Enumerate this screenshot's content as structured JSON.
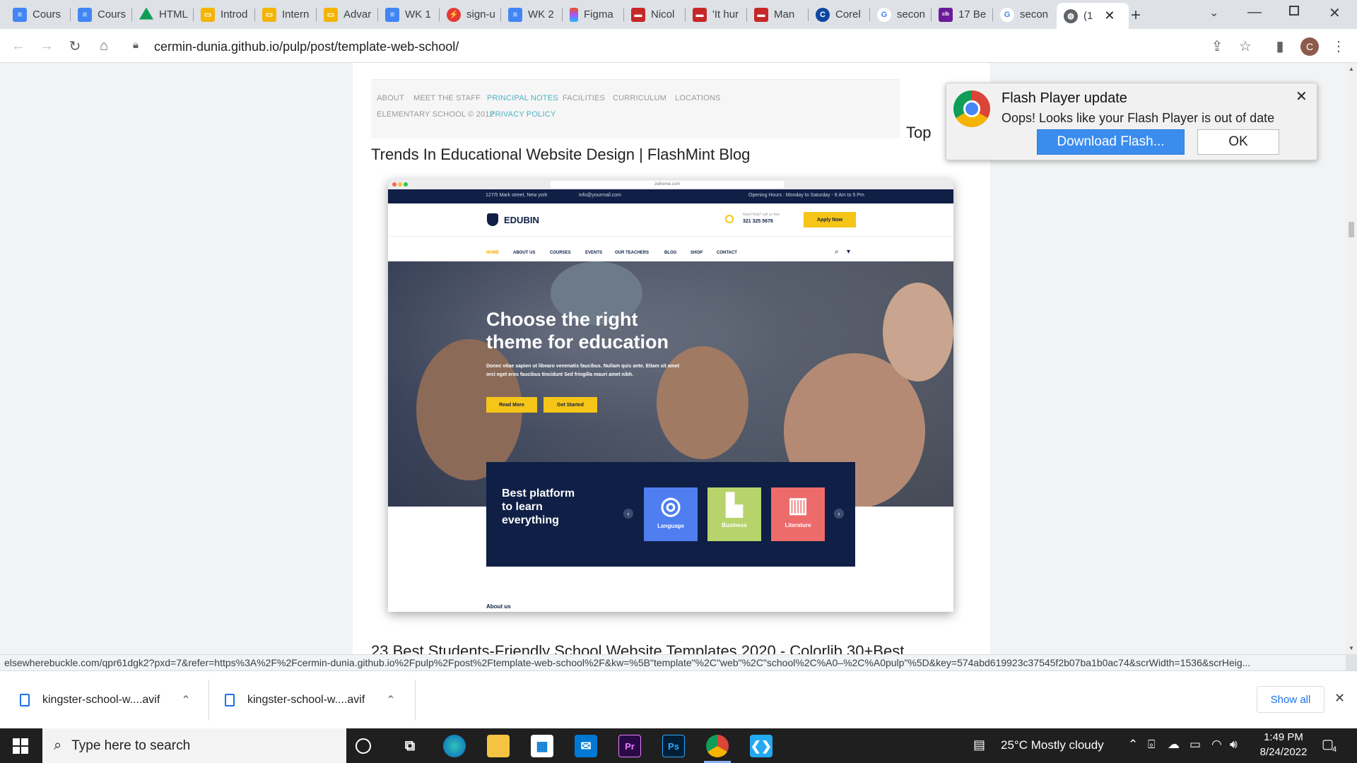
{
  "browser": {
    "tabs": [
      {
        "title": "Cours",
        "icon": "docs-icon",
        "color": "#4285f4"
      },
      {
        "title": "Cours",
        "icon": "docs-icon",
        "color": "#4285f4"
      },
      {
        "title": "HTML",
        "icon": "drive-icon",
        "color": "#0f9d58"
      },
      {
        "title": "Introd",
        "icon": "slides-icon",
        "color": "#f4b400"
      },
      {
        "title": "Intern",
        "icon": "slides-icon",
        "color": "#f4b400"
      },
      {
        "title": "Advar",
        "icon": "slides-icon",
        "color": "#f4b400"
      },
      {
        "title": "WK 1",
        "icon": "docs-icon",
        "color": "#4285f4"
      },
      {
        "title": "sign-u",
        "icon": "red-circle-icon",
        "color": "#e53935"
      },
      {
        "title": "WK 2",
        "icon": "docs-icon",
        "color": "#4285f4"
      },
      {
        "title": "Figma",
        "icon": "figma-icon",
        "color": "#f24e1e"
      },
      {
        "title": "Nicol",
        "icon": "mail-icon",
        "color": "#c62828"
      },
      {
        "title": "'It hur",
        "icon": "mail-icon",
        "color": "#c62828"
      },
      {
        "title": "Man",
        "icon": "mail-icon",
        "color": "#c62828"
      },
      {
        "title": "Corel",
        "icon": "corel-icon",
        "color": "#0d47a1"
      },
      {
        "title": "secon",
        "icon": "google-icon",
        "color": "#4285f4"
      },
      {
        "title": "17 Be",
        "icon": "colorlib-icon",
        "color": "#6a1b9a"
      },
      {
        "title": "secon",
        "icon": "google-icon",
        "color": "#4285f4"
      },
      {
        "title": "(1",
        "icon": "globe-icon",
        "color": "#5f6368"
      }
    ],
    "url": "cermin-dunia.github.io/pulp/post/template-web-school/",
    "profile_initial": "C"
  },
  "page": {
    "footer_nav": [
      "ABOUT",
      "MEET THE STAFF",
      "PRINCIPAL NOTES",
      "FACILITIES",
      "CURRICULUM",
      "LOCATIONS"
    ],
    "footer_copyright": "ELEMENTARY SCHOOL © 2012",
    "footer_privacy": "PRIVACY POLICY",
    "top_link": "Top",
    "article1_title": "Trends In Educational Website Design | FlashMint Blog",
    "article2_title": "23 Best Students-Friendly School Website Templates 2020 - Colorlib  30+Best",
    "template": {
      "address": "127/5 Mark street, New york",
      "email": "info@yourmail.com",
      "hours": "Opening Hours : Monday to Saturday - 8 Am to 5 Pm",
      "url_bar": "zetheme.com",
      "logo": "EDUBIN",
      "help_label": "Need Help? call us free",
      "phone": "321 325 5678",
      "apply": "Apply Now",
      "nav": [
        "HOME",
        "ABOUT US",
        "COURSES",
        "EVENTS",
        "OUR TEACHERS",
        "BLOG",
        "SHOP",
        "CONTACT"
      ],
      "hero_title_1": "Choose the right",
      "hero_title_2": "theme for education",
      "hero_text_1": "Donec vitae sapien ut libearo venenatis faucibus. Nullam quis ante. Etiam sit amet",
      "hero_text_2": "orci eget eros faucibus tincidunt Sed fringilla mauri amet nibh.",
      "btn_read": "Read More",
      "btn_start": "Get Started",
      "best_1": "Best platform",
      "best_2": "to learn",
      "best_3": "everything",
      "categories": [
        {
          "label": "Language",
          "color": "#4e7ef0"
        },
        {
          "label": "Business",
          "color": "#b7d36b"
        },
        {
          "label": "Literature",
          "color": "#ee6b6b"
        }
      ],
      "about": "About us"
    }
  },
  "flash_popup": {
    "title": "Flash Player update",
    "message": "Oops! Looks like your Flash Player is out of date",
    "download": "Download Flash...",
    "ok": "OK"
  },
  "status_url": "elsewherebuckle.com/qpr61dgk2?pxd=7&refer=https%3A%2F%2Fcermin-dunia.github.io%2Fpulp%2Fpost%2Ftemplate-web-school%2F&kw=%5B\"template\"%2C\"web\"%2C\"school%2C%A0–%2C%A0pulp\"%5D&key=574abd619923c37545f2b07ba1b0ac74&scrWidth=1536&scrHeig...",
  "downloads": [
    {
      "name": "kingster-school-w....avif"
    },
    {
      "name": "kingster-school-w....avif"
    }
  ],
  "show_all": "Show all",
  "taskbar": {
    "search_placeholder": "Type here to search",
    "weather": "25°C  Mostly cloudy",
    "time": "1:49 PM",
    "date": "8/24/2022",
    "notifications": "4"
  }
}
